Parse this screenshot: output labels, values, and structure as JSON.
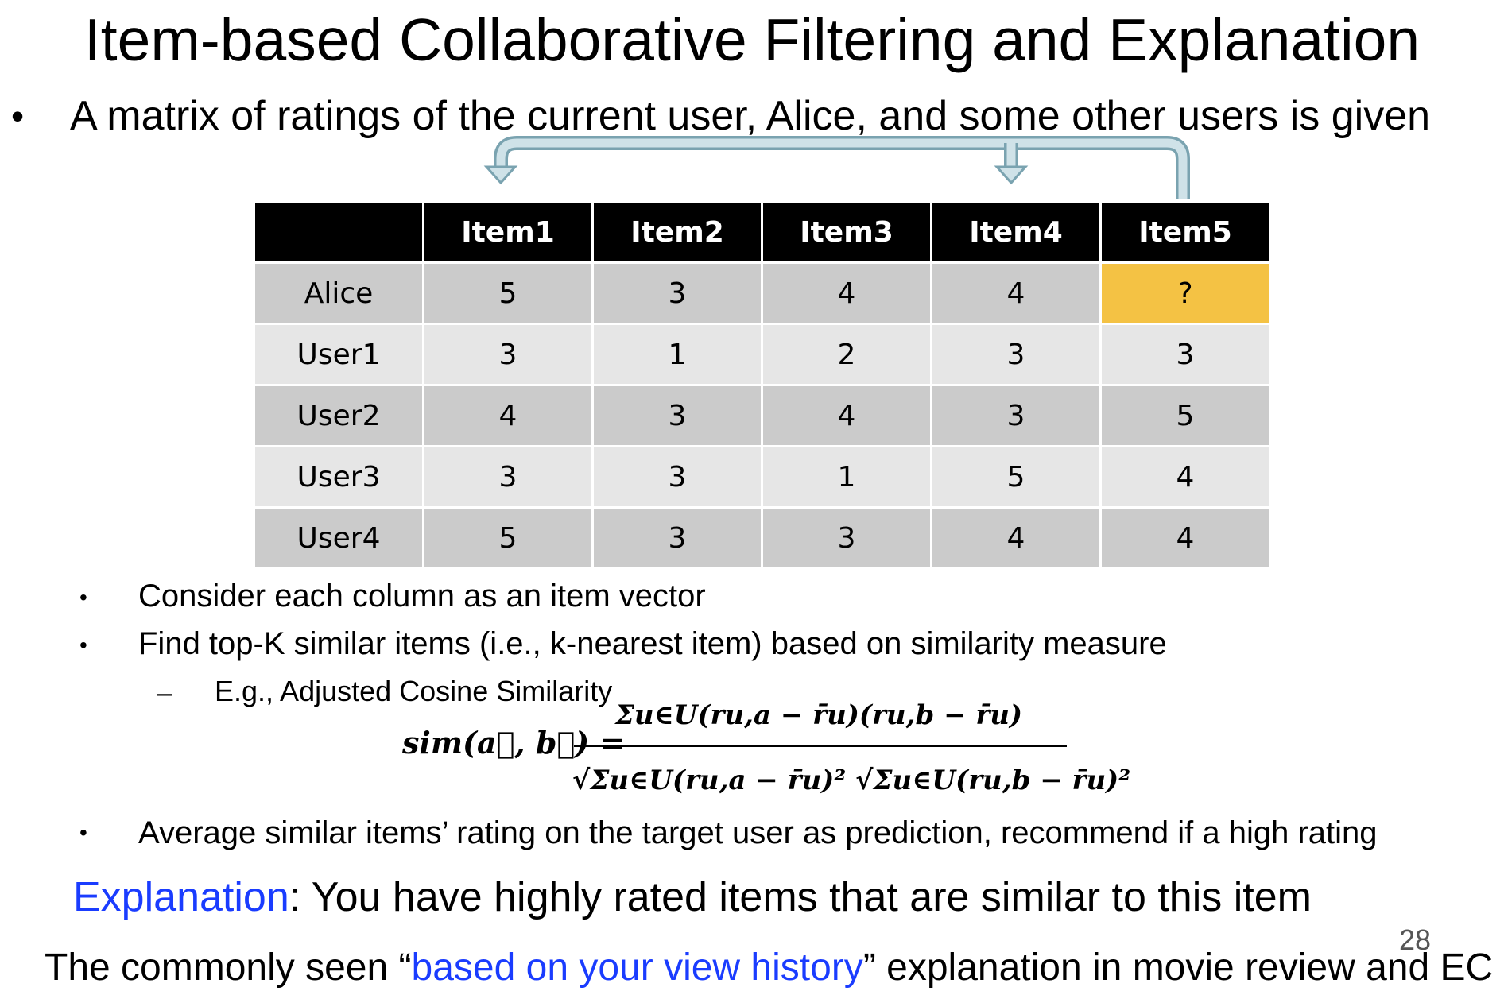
{
  "title": "Item-based Collaborative Filtering and Explanation",
  "intro": "A matrix of ratings of the current user, Alice, and some other users is given",
  "bullet_symbol": "•",
  "dash_symbol": "–",
  "table": {
    "headers": [
      "",
      "Item1",
      "Item2",
      "Item3",
      "Item4",
      "Item5"
    ],
    "rows": [
      {
        "user": "Alice",
        "ratings": [
          "5",
          "3",
          "4",
          "4",
          "?"
        ]
      },
      {
        "user": "User1",
        "ratings": [
          "3",
          "1",
          "2",
          "3",
          "3"
        ]
      },
      {
        "user": "User2",
        "ratings": [
          "4",
          "3",
          "4",
          "3",
          "5"
        ]
      },
      {
        "user": "User3",
        "ratings": [
          "3",
          "3",
          "1",
          "5",
          "4"
        ]
      },
      {
        "user": "User4",
        "ratings": [
          "5",
          "3",
          "3",
          "4",
          "4"
        ]
      }
    ],
    "highlight_color": "#f4c244",
    "header_color": "#000000"
  },
  "points": [
    "Consider each column as an item vector",
    "Find top-K similar items (i.e., k-nearest item) based on similarity measure"
  ],
  "sub_point": "E.g., Adjusted Cosine Similarity",
  "formula": {
    "lhs": "sim(a⃗, b⃗) =",
    "numerator": "Σu∈U(ru,a − r̄u)(ru,b − r̄u)",
    "denominator": "√Σu∈U(ru,a − r̄u)² √Σu∈U(ru,b − r̄u)²"
  },
  "point_last": "Average similar items’ rating on the target user as prediction, recommend if a high rating",
  "explanation": {
    "label": "Explanation",
    "text": ": You have highly rated items that are similar to this item"
  },
  "page_number": "28",
  "footer": {
    "prefix": "The commonly seen “",
    "highlight": "based on your view history",
    "suffix": "” explanation in movie review and EC"
  },
  "colors": {
    "accent_blue": "#1a3cff",
    "arrow_fill": "#b8d4dd",
    "arrow_stroke": "#7aa3b0"
  }
}
